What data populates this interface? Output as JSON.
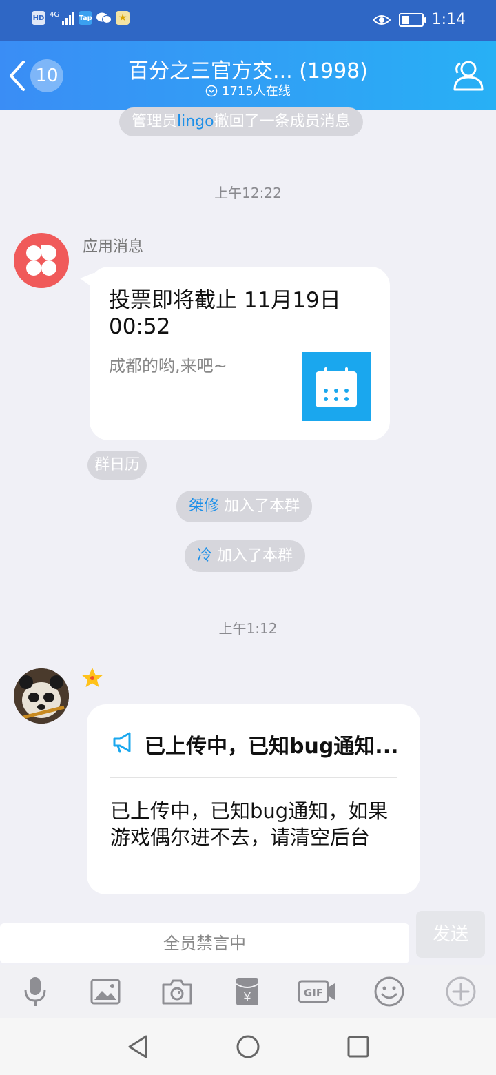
{
  "status_bar": {
    "left_icons": [
      "HD",
      "4G",
      "Tap",
      "wechat-icon",
      "star-app-icon"
    ],
    "time": "1:14",
    "battery_level": 0.35
  },
  "header": {
    "unread_count": "10",
    "title": "百分之三官方交... (1998)",
    "online": "1715人在线"
  },
  "chat": {
    "recall_notice": {
      "prefix": "管理员",
      "user": "lingo",
      "suffix": "撤回了一条成员消息"
    },
    "time1": "上午12:22",
    "app_message": {
      "sender": "应用消息",
      "title": "投票即将截止 11月19日 00:52",
      "subtitle": "成都的哟,来吧~",
      "source_tag": "群日历"
    },
    "join1": {
      "user": "桀修",
      "text": " 加入了本群"
    },
    "join2": {
      "user": "冷",
      "text": " 加入了本群"
    },
    "time2": "上午1:12",
    "notice": {
      "title": "已上传中，已知bug通知...",
      "body": "已上传中，已知bug通知，如果游戏偶尔进不去，请清空后台"
    }
  },
  "input": {
    "placeholder": "全员禁言中",
    "send_label": "发送"
  },
  "toolbar": {
    "items": [
      "microphone-icon",
      "image-icon",
      "camera-icon",
      "red-packet-icon",
      "gif-icon",
      "emoji-icon",
      "plus-icon"
    ],
    "gif_label": "GIF",
    "yen_label": "¥"
  },
  "colors": {
    "header_start": "#3a8df5",
    "header_end": "#28b0f5",
    "accent_blue": "#1e90e8",
    "calendar_blue": "#1aa7ee",
    "app_avatar_red": "#f05a5a"
  }
}
